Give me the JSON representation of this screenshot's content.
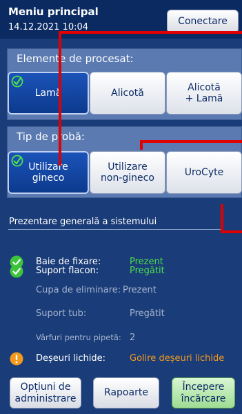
{
  "header": {
    "title": "Meniu principal",
    "datetime": "14.12.2021 10:04",
    "connect_label": "Conectare"
  },
  "process_section": {
    "label": "Elemente de procesat:",
    "options": [
      {
        "label": "Lamă",
        "selected": true
      },
      {
        "label": "Alicotă",
        "selected": false
      },
      {
        "label": "Alicotă\n+ Lamă",
        "selected": false
      }
    ]
  },
  "sample_section": {
    "label": "Tip de probă:",
    "options": [
      {
        "label": "Utilizare\ngineco",
        "selected": true
      },
      {
        "label": "Utilizare\nnon-gineco",
        "selected": false
      },
      {
        "label": "UroCyte",
        "selected": false
      }
    ]
  },
  "overview": {
    "title": "Prezentare generală a sistemului",
    "rows": [
      {
        "label": "Baie de fixare:",
        "value": "Prezent",
        "status": "ok"
      },
      {
        "label": "Suport flacon:",
        "value": "Pregătit",
        "status": "ok"
      },
      {
        "label": "Cupa de eliminare:",
        "value": "Prezent",
        "status": "dim"
      },
      {
        "label": "Suport tub:",
        "value": "Pregătit",
        "status": "dim"
      },
      {
        "label": "Vârfuri pentru pipetă:",
        "value": "2",
        "status": "dim"
      },
      {
        "label": "Deșeuri lichide:",
        "value": "Golire deșeuri lichide",
        "status": "warn"
      }
    ]
  },
  "footer": {
    "admin_label": "Opțiuni de\nadministrare",
    "reports_label": "Rapoarte",
    "start_label": "Începere\nîncărcare"
  },
  "colors": {
    "background": "#1a3c78",
    "header": "#0b2a62",
    "panel": "#5a7ab1",
    "selected": "#0c3a8e",
    "ok": "#4ee04c",
    "warn": "#f39a1e",
    "pointer_lines": "#e00000"
  },
  "icons": {
    "selected_mark": "check-icon",
    "status_ok": "check-circle-icon",
    "status_warn": "exclamation-circle-icon"
  }
}
